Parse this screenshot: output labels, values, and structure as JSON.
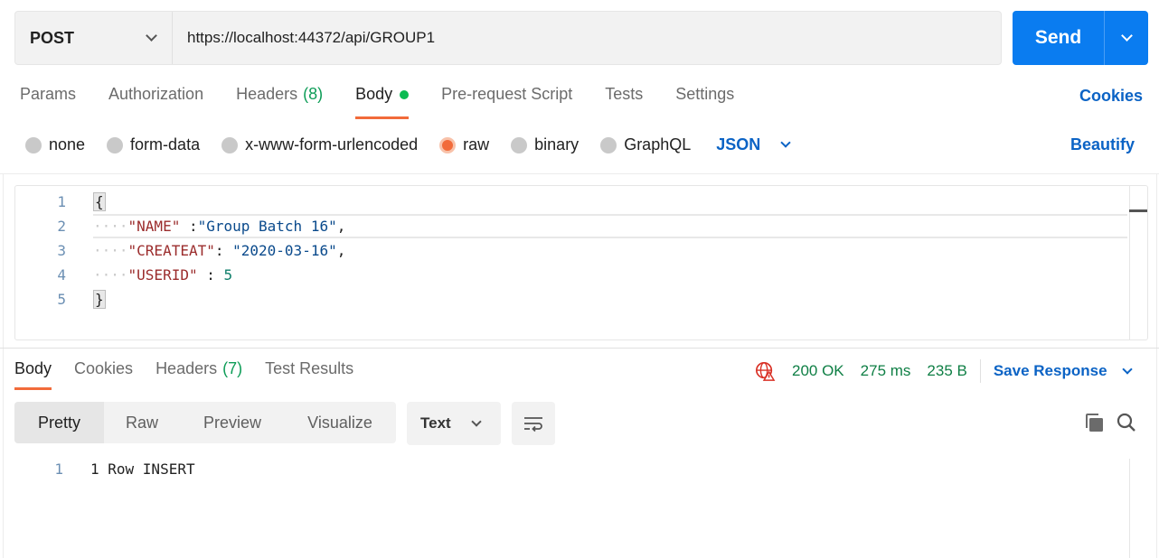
{
  "request": {
    "method": "POST",
    "url": "https://localhost:44372/api/GROUP1",
    "send_label": "Send"
  },
  "request_tabs": [
    {
      "label": "Params"
    },
    {
      "label": "Authorization"
    },
    {
      "label": "Headers",
      "count": "(8)"
    },
    {
      "label": "Body"
    },
    {
      "label": "Pre-request Script"
    },
    {
      "label": "Tests"
    },
    {
      "label": "Settings"
    }
  ],
  "cookies_label": "Cookies",
  "body_types": [
    {
      "label": "none"
    },
    {
      "label": "form-data"
    },
    {
      "label": "x-www-form-urlencoded"
    },
    {
      "label": "raw"
    },
    {
      "label": "binary"
    },
    {
      "label": "GraphQL"
    }
  ],
  "body_language": "JSON",
  "beautify_label": "Beautify",
  "editor": {
    "line_numbers": [
      "1",
      "2",
      "3",
      "4",
      "5"
    ],
    "open_brace": "{",
    "close_brace": "}",
    "line2": {
      "key": "\"NAME\"",
      "sep": " :",
      "value": "\"Group Batch 16\"",
      "end": ","
    },
    "line3": {
      "key": "\"CREATEAT\"",
      "sep": ": ",
      "value": "\"2020-03-16\"",
      "end": ","
    },
    "line4": {
      "key": "\"USERID\"",
      "sep": " : ",
      "value": "5",
      "end": ""
    }
  },
  "response_tabs": [
    {
      "label": "Body"
    },
    {
      "label": "Cookies"
    },
    {
      "label": "Headers",
      "count": "(7)"
    },
    {
      "label": "Test Results"
    }
  ],
  "response_status": {
    "status": "200 OK",
    "time": "275 ms",
    "size": "235 B",
    "save_label": "Save Response"
  },
  "view_modes": [
    {
      "label": "Pretty"
    },
    {
      "label": "Raw"
    },
    {
      "label": "Preview"
    },
    {
      "label": "Visualize"
    }
  ],
  "format_label": "Text",
  "response_body": {
    "line_number": "1",
    "text": "1 Row INSERT"
  },
  "colors": {
    "accent_orange": "#f26b3a",
    "send_blue": "#0a7cf0",
    "link_blue": "#0b63c5",
    "status_green": "#0f7f45"
  }
}
